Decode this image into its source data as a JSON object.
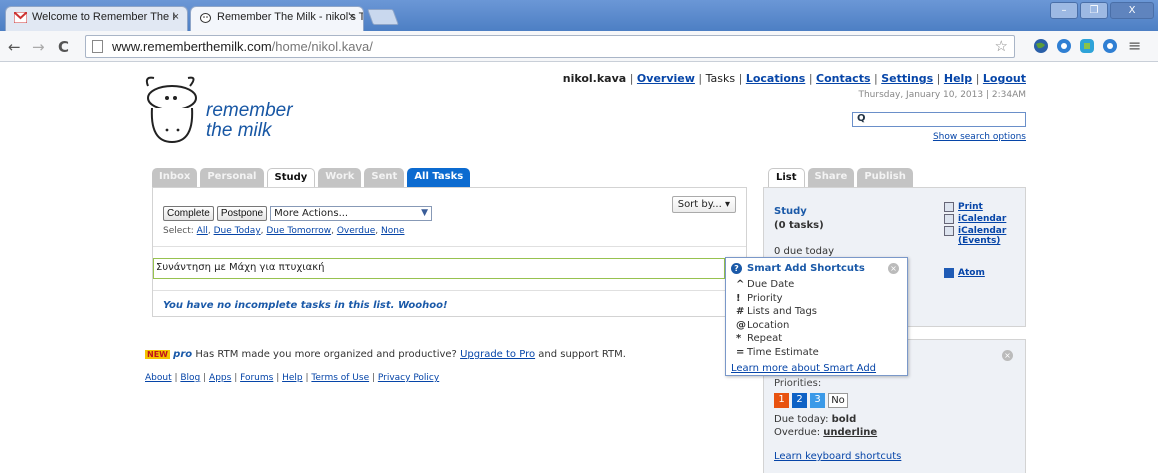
{
  "browser": {
    "tabs": [
      {
        "label": "Welcome to Remember The I",
        "close": "×"
      },
      {
        "label": "Remember The Milk - nikol's T",
        "close": "×"
      }
    ],
    "nav": {
      "back": "←",
      "forward": "→",
      "reload": "C"
    },
    "url_host": "www.rememberthemilk.com",
    "url_path": "/home/nikol.kava/",
    "star": "☆",
    "menu": "≡",
    "window_buttons": {
      "minimize": "–",
      "restore": "❐",
      "close": "X"
    }
  },
  "logo": {
    "line1": "remember",
    "line2": "the milk"
  },
  "topnav": {
    "user": "nikol.kava",
    "overview": "Overview",
    "tasks": "Tasks",
    "locations": "Locations",
    "contacts": "Contacts",
    "settings": "Settings",
    "help": "Help",
    "logout": "Logout",
    "datetime": "Thursday, January 10, 2013 | 2:34AM"
  },
  "search": {
    "icon": "search-icon",
    "show_options": "Show search options"
  },
  "list_tabs": [
    "Inbox",
    "Personal",
    "Study",
    "Work",
    "Sent",
    "All Tasks"
  ],
  "task_panel": {
    "complete_button": "Complete",
    "postpone_button": "Postpone",
    "more_actions": "More Actions...",
    "sort_by": "Sort by...",
    "select_label": "Select:",
    "select_all": "All",
    "select_due_today": "Due Today",
    "select_due_tomorrow": "Due Tomorrow",
    "select_overdue": "Overdue",
    "select_none": "None",
    "add_input_value": "Συνάντηση με Μάχη για πτυχιακή",
    "empty_message": "You have no incomplete tasks in this list. Woohoo!"
  },
  "promo": {
    "new_badge": "NEW",
    "pro_badge": "pro",
    "text": "Has RTM made you more organized and productive?",
    "link": "Upgrade to Pro",
    "text_after": "and support RTM."
  },
  "footer": [
    "About",
    "Blog",
    "Apps",
    "Forums",
    "Help",
    "Terms of Use",
    "Privacy Policy"
  ],
  "right_tabs": [
    "List",
    "Share",
    "Publish"
  ],
  "list_info": {
    "title": "Study",
    "count": "(0 tasks)",
    "due_today": "0 due today",
    "links": {
      "print": "Print",
      "icalendar": "iCalendar",
      "icalendar_events_1": "iCalendar",
      "icalendar_events_2": "(Events)",
      "atom": "Atom"
    }
  },
  "priorities_panel": {
    "label": "Priorities:",
    "p1": "1",
    "p2": "2",
    "p3": "3",
    "none": "No",
    "due_today_label": "Due today:",
    "due_today_style": "bold",
    "overdue_label": "Overdue:",
    "overdue_style": "underline",
    "keyboard_link": "Learn keyboard shortcuts"
  },
  "smart_add": {
    "title": "Smart Add Shortcuts",
    "items": [
      {
        "key": "^",
        "label": "Due Date"
      },
      {
        "key": "!",
        "label": "Priority"
      },
      {
        "key": "#",
        "label": "Lists and Tags"
      },
      {
        "key": "@",
        "label": "Location"
      },
      {
        "key": "*",
        "label": "Repeat"
      },
      {
        "key": "=",
        "label": "Time Estimate"
      }
    ],
    "learn_more": "Learn more about Smart Add"
  },
  "colors": {
    "brand_blue": "#1a59a8",
    "active_tab_blue": "#0c6bd0",
    "p1": "#e8520f",
    "p2": "#0d61c5",
    "p3": "#3b9ae8"
  }
}
